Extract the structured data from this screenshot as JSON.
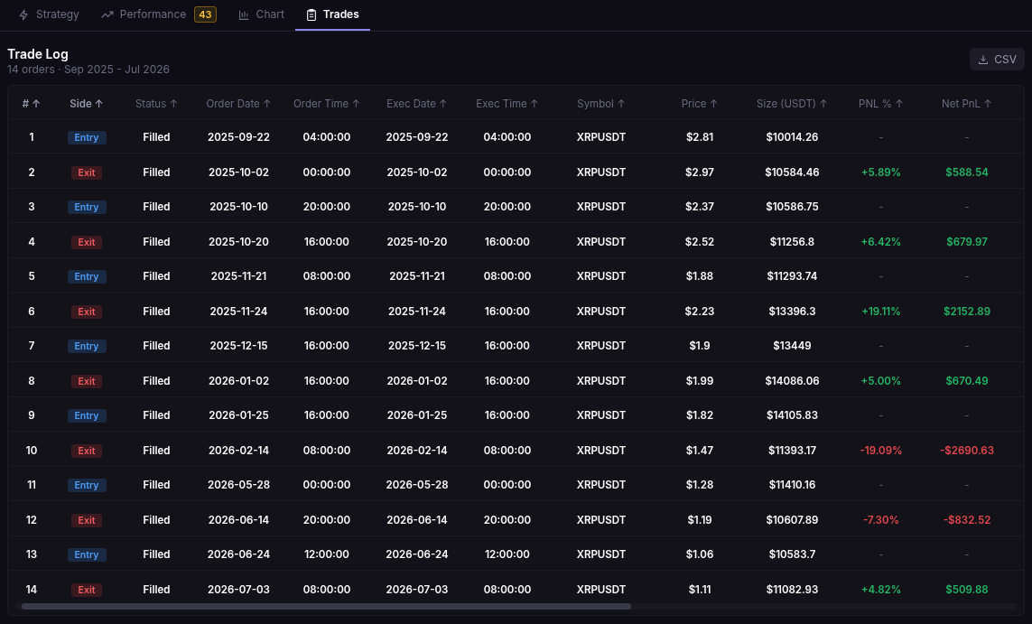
{
  "tabs": [
    {
      "label": "Strategy",
      "selected": false
    },
    {
      "label": "Performance",
      "badge": "43",
      "selected": false
    },
    {
      "label": "Chart",
      "selected": false
    },
    {
      "label": "Trades",
      "selected": true
    }
  ],
  "title": "Trade Log",
  "subtitle": "14 orders · Sep 2025 - Jul 2026",
  "export_button": "CSV",
  "table": {
    "columns": [
      {
        "label": "#",
        "sort": "↑",
        "bright": true
      },
      {
        "label": "Side",
        "sort": "↑",
        "bright": true
      },
      {
        "label": "Status",
        "sort": "↑",
        "bright": false
      },
      {
        "label": "Order Date",
        "sort": "↑",
        "bright": false
      },
      {
        "label": "Order Time",
        "sort": "↑",
        "bright": false
      },
      {
        "label": "Exec Date",
        "sort": "↑",
        "bright": false
      },
      {
        "label": "Exec Time",
        "sort": "↑",
        "bright": false
      },
      {
        "label": "Symbol",
        "sort": "↑",
        "bright": false
      },
      {
        "label": "Price",
        "sort": "↑",
        "bright": false
      },
      {
        "label": "Size (USDT)",
        "sort": "↑",
        "bright": false
      },
      {
        "label": "PNL %",
        "sort": "↑",
        "bright": false
      },
      {
        "label": "Net PnL",
        "sort": "↑",
        "bright": false
      }
    ],
    "rows": [
      {
        "n": "1",
        "side": "Entry",
        "kind": "entry",
        "status": "Filled",
        "order_date": "2025-09-22",
        "order_time": "04:00:00",
        "exec_date": "2025-09-22",
        "exec_time": "04:00:00",
        "symbol": "XRPUSDT",
        "price": "$2.81",
        "size": "$10014.26",
        "pnl_pct": "-",
        "net_pnl": "-",
        "color": "#5d5c70"
      },
      {
        "n": "2",
        "side": "Exit",
        "kind": "exit",
        "status": "Filled",
        "order_date": "2025-10-02",
        "order_time": "00:00:00",
        "exec_date": "2025-10-02",
        "exec_time": "00:00:00",
        "symbol": "XRPUSDT",
        "price": "$2.97",
        "size": "$10584.46",
        "pnl_pct": "+5.89%",
        "net_pnl": "$588.54",
        "color": "#22b866"
      },
      {
        "n": "3",
        "side": "Entry",
        "kind": "entry",
        "status": "Filled",
        "order_date": "2025-10-10",
        "order_time": "20:00:00",
        "exec_date": "2025-10-10",
        "exec_time": "20:00:00",
        "symbol": "XRPUSDT",
        "price": "$2.37",
        "size": "$10586.75",
        "pnl_pct": "-",
        "net_pnl": "-",
        "color": "#5d5c70"
      },
      {
        "n": "4",
        "side": "Exit",
        "kind": "exit",
        "status": "Filled",
        "order_date": "2025-10-20",
        "order_time": "16:00:00",
        "exec_date": "2025-10-20",
        "exec_time": "16:00:00",
        "symbol": "XRPUSDT",
        "price": "$2.52",
        "size": "$11256.8",
        "pnl_pct": "+6.42%",
        "net_pnl": "$679.97",
        "color": "#22b866"
      },
      {
        "n": "5",
        "side": "Entry",
        "kind": "entry",
        "status": "Filled",
        "order_date": "2025-11-21",
        "order_time": "08:00:00",
        "exec_date": "2025-11-21",
        "exec_time": "08:00:00",
        "symbol": "XRPUSDT",
        "price": "$1.88",
        "size": "$11293.74",
        "pnl_pct": "-",
        "net_pnl": "-",
        "color": "#5d5c70"
      },
      {
        "n": "6",
        "side": "Exit",
        "kind": "exit",
        "status": "Filled",
        "order_date": "2025-11-24",
        "order_time": "16:00:00",
        "exec_date": "2025-11-24",
        "exec_time": "16:00:00",
        "symbol": "XRPUSDT",
        "price": "$2.23",
        "size": "$13396.3",
        "pnl_pct": "+19.11%",
        "net_pnl": "$2152.89",
        "color": "#22b866"
      },
      {
        "n": "7",
        "side": "Entry",
        "kind": "entry",
        "status": "Filled",
        "order_date": "2025-12-15",
        "order_time": "16:00:00",
        "exec_date": "2025-12-15",
        "exec_time": "16:00:00",
        "symbol": "XRPUSDT",
        "price": "$1.9",
        "size": "$13449",
        "pnl_pct": "-",
        "net_pnl": "-",
        "color": "#5d5c70"
      },
      {
        "n": "8",
        "side": "Exit",
        "kind": "exit",
        "status": "Filled",
        "order_date": "2026-01-02",
        "order_time": "16:00:00",
        "exec_date": "2026-01-02",
        "exec_time": "16:00:00",
        "symbol": "XRPUSDT",
        "price": "$1.99",
        "size": "$14086.06",
        "pnl_pct": "+5.00%",
        "net_pnl": "$670.49",
        "color": "#22b866"
      },
      {
        "n": "9",
        "side": "Entry",
        "kind": "entry",
        "status": "Filled",
        "order_date": "2026-01-25",
        "order_time": "16:00:00",
        "exec_date": "2026-01-25",
        "exec_time": "16:00:00",
        "symbol": "XRPUSDT",
        "price": "$1.82",
        "size": "$14105.83",
        "pnl_pct": "-",
        "net_pnl": "-",
        "color": "#5d5c70"
      },
      {
        "n": "10",
        "side": "Exit",
        "kind": "exit",
        "status": "Filled",
        "order_date": "2026-02-14",
        "order_time": "08:00:00",
        "exec_date": "2026-02-14",
        "exec_time": "08:00:00",
        "symbol": "XRPUSDT",
        "price": "$1.47",
        "size": "$11393.17",
        "pnl_pct": "-19.09%",
        "net_pnl": "-$2690.63",
        "color": "#e5484d"
      },
      {
        "n": "11",
        "side": "Entry",
        "kind": "entry",
        "status": "Filled",
        "order_date": "2026-05-28",
        "order_time": "00:00:00",
        "exec_date": "2026-05-28",
        "exec_time": "00:00:00",
        "symbol": "XRPUSDT",
        "price": "$1.28",
        "size": "$11410.16",
        "pnl_pct": "-",
        "net_pnl": "-",
        "color": "#5d5c70"
      },
      {
        "n": "12",
        "side": "Exit",
        "kind": "exit",
        "status": "Filled",
        "order_date": "2026-06-14",
        "order_time": "20:00:00",
        "exec_date": "2026-06-14",
        "exec_time": "20:00:00",
        "symbol": "XRPUSDT",
        "price": "$1.19",
        "size": "$10607.89",
        "pnl_pct": "-7.30%",
        "net_pnl": "-$832.52",
        "color": "#e5484d"
      },
      {
        "n": "13",
        "side": "Entry",
        "kind": "entry",
        "status": "Filled",
        "order_date": "2026-06-24",
        "order_time": "12:00:00",
        "exec_date": "2026-06-24",
        "exec_time": "12:00:00",
        "symbol": "XRPUSDT",
        "price": "$1.06",
        "size": "$10583.7",
        "pnl_pct": "-",
        "net_pnl": "-",
        "color": "#5d5c70"
      },
      {
        "n": "14",
        "side": "Exit",
        "kind": "exit",
        "status": "Filled",
        "order_date": "2026-07-03",
        "order_time": "08:00:00",
        "exec_date": "2026-07-03",
        "exec_time": "08:00:00",
        "symbol": "XRPUSDT",
        "price": "$1.11",
        "size": "$11082.93",
        "pnl_pct": "+4.82%",
        "net_pnl": "$509.88",
        "color": "#22b866"
      }
    ]
  }
}
